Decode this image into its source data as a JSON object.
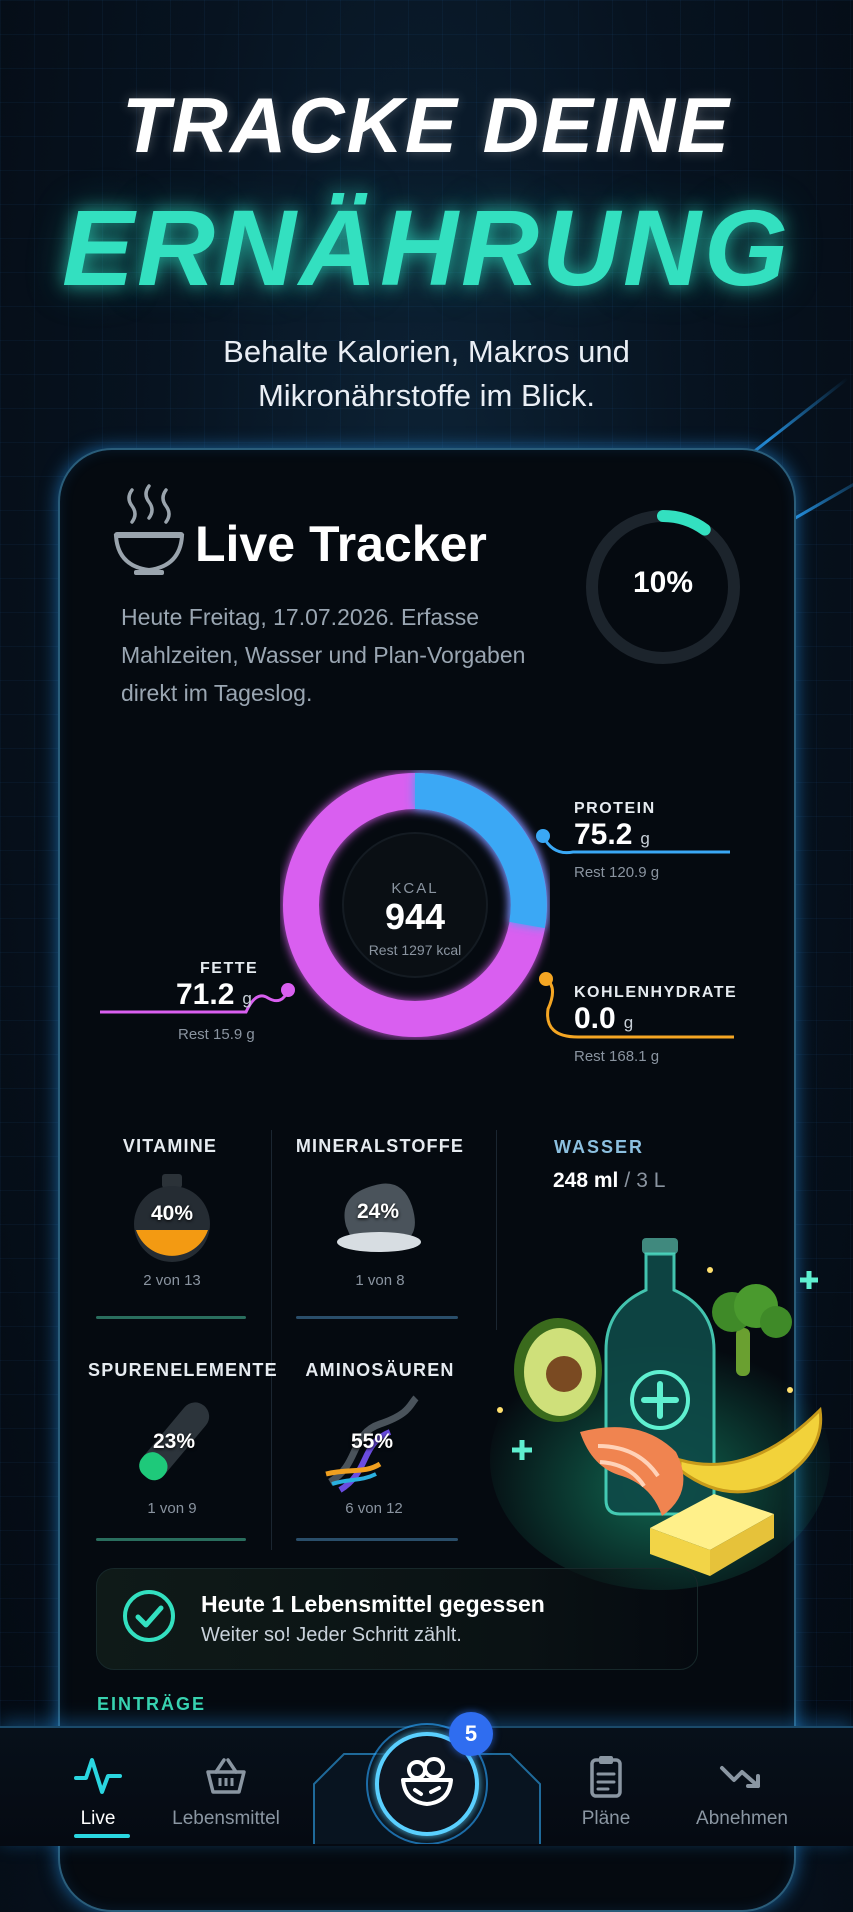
{
  "hero": {
    "title_line1": "TRACKE DEINE",
    "title_line2": "ERNÄHRUNG",
    "subtitle_line1": "Behalte Kalorien, Makros und",
    "subtitle_line2": "Mikronährstoffe im Blick."
  },
  "tracker": {
    "title": "Live Tracker",
    "description": "Heute Freitag, 17.07.2026. Erfasse Mahlzeiten, Wasser und Plan-Vorgaben direkt im Tageslog.",
    "progress_percent": 10,
    "progress_label": "10%"
  },
  "kcal": {
    "label": "KCAL",
    "value": "944",
    "rest": "Rest 1297 kcal"
  },
  "macros": {
    "protein": {
      "name": "PROTEIN",
      "value": "75.2",
      "unit": "g",
      "rest": "Rest 120.9 g",
      "color": "#3aa8f5"
    },
    "kohlenhydrate": {
      "name": "KOHLENHYDRATE",
      "value": "0.0",
      "unit": "g",
      "rest": "Rest 168.1 g",
      "color": "#f5a623"
    },
    "fette": {
      "name": "FETTE",
      "value": "71.2",
      "unit": "g",
      "rest": "Rest 15.9 g",
      "color": "#d95ff0"
    }
  },
  "micros": [
    {
      "name": "VITAMINE",
      "percent": "40%",
      "count": "2 von 13",
      "icon": "flask-icon"
    },
    {
      "name": "MINERALSTOFFE",
      "percent": "24%",
      "count": "1 von 8",
      "icon": "mineral-rock-icon"
    },
    {
      "name": "SPURENELEMENTE",
      "percent": "23%",
      "count": "1 von 9",
      "icon": "test-tube-icon"
    },
    {
      "name": "AMINOSÄUREN",
      "percent": "55%",
      "count": "6 von 12",
      "icon": "dna-icon"
    }
  ],
  "wasser": {
    "title": "WASSER",
    "value": "248 ml",
    "separator": "/",
    "total": "3 L"
  },
  "banner": {
    "title": "Heute 1 Lebensmittel gegessen",
    "subtitle": "Weiter so! Jeder Schritt zählt."
  },
  "entries_heading": "EINTRÄGE",
  "nav": {
    "items": [
      {
        "label": "Live",
        "icon": "activity-pulse-icon",
        "active": true
      },
      {
        "label": "Lebensmittel",
        "icon": "basket-icon",
        "active": false
      },
      {
        "label": "Pläne",
        "icon": "clipboard-icon",
        "active": false
      },
      {
        "label": "Abnehmen",
        "icon": "trend-down-icon",
        "active": false
      }
    ],
    "center_icon": "salad-bowl-icon",
    "badge": "5"
  },
  "colors": {
    "accent": "#33e0c0",
    "protein": "#3aa8f5",
    "fat": "#d95ff0",
    "carbs": "#f5a623",
    "badge": "#2f6df0"
  }
}
